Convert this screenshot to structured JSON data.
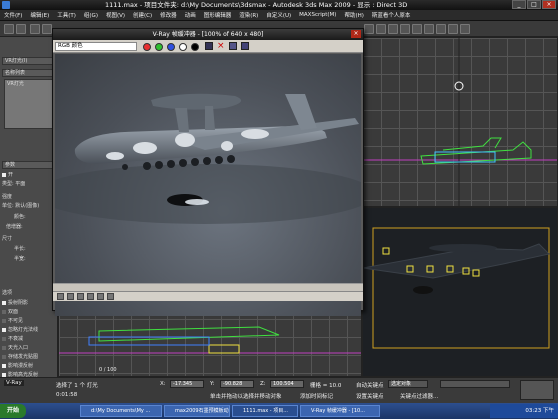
{
  "window": {
    "title": "1111.max    - 项目文件夹: d:\\My Documents\\3dsmax    - Autodesk 3ds Max  2009    - 显示 : Direct 3D",
    "minimize": "_",
    "maximize": "□",
    "close": "×"
  },
  "menu": [
    "文件(F)",
    "编辑(E)",
    "工具(T)",
    "组(G)",
    "视图(V)",
    "创建(C)",
    "修改器",
    "动画",
    "图形编辑器",
    "渲染(R)",
    "自定义(U)",
    "MAXScript(M)",
    "帮助(H)",
    "斯蓝看个人原本"
  ],
  "left_panel": {
    "header1": "VR灯光(I)",
    "header2": "名称列表",
    "list_item": "VR灯光",
    "param_header": "参数",
    "on_label": "开",
    "type_label": "类型:",
    "type_value": "平面",
    "intensity_header": "强度",
    "unit_label": "单位:",
    "unit_value": "默认(图像)",
    "color_label": "颜色:",
    "multiplier_label": "倍增器:",
    "size_header": "尺寸",
    "half_length": "半长:",
    "half_width": "半宽:",
    "options_header": "选项",
    "options": [
      {
        "label": "投射阴影",
        "checked": true
      },
      {
        "label": "双面",
        "checked": false
      },
      {
        "label": "不可见",
        "checked": false
      },
      {
        "label": "忽略灯光法线",
        "checked": true
      },
      {
        "label": "不衰减",
        "checked": false
      },
      {
        "label": "天光入口",
        "checked": false
      },
      {
        "label": "存储发光贴图",
        "checked": false
      },
      {
        "label": "影响漫反射",
        "checked": true
      },
      {
        "label": "影响高光反射",
        "checked": true
      }
    ]
  },
  "vfb": {
    "title": "V-Ray 帧缓冲器 - [100% of 640 x 480]",
    "channel": "RGB 颜色",
    "colors": [
      "#e83030",
      "#30c030",
      "#3050e0",
      "#ffffff",
      "#000000"
    ]
  },
  "timeline": {
    "frame": "0 / 100"
  },
  "status": {
    "selected": "选择了 1 个 灯光",
    "hint": "单击并拖动以选择并移动对象",
    "x_label": "X:",
    "x_value": "-17.345",
    "y_label": "Y:",
    "y_value": "-90.828",
    "z_label": "Z:",
    "z_value": "100.504",
    "grid": "栅格 = 10.0",
    "autokey": "自动关键点",
    "setkey": "设置关键点",
    "selobj": "选定对象",
    "keyfilter": "关键点过滤器...",
    "add_time_tag": "添加时间标记",
    "time_display": "0:01:58"
  },
  "taskbar": {
    "start": "开始",
    "tasks": [
      "d:\\My Documents\\My ...",
      "max2009石墨预模板动...",
      "1111.max   - 项目...",
      "V-Ray 帧缓冲器 - [10..."
    ],
    "clock": "03:23 下午"
  }
}
